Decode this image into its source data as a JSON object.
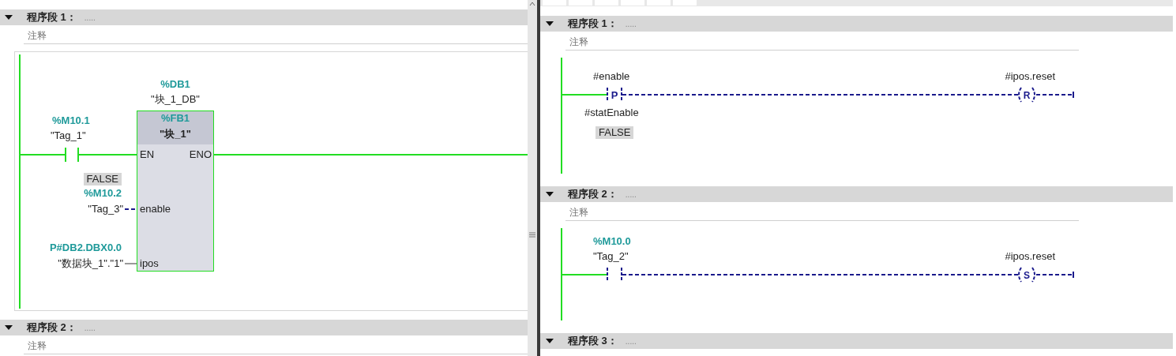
{
  "left_pane": {
    "networks": [
      {
        "title": "程序段 1：",
        "dots": ".....",
        "expanded": true,
        "comment": "注释",
        "rung": {
          "kind": "fb_call",
          "instance": {
            "address": "%DB1",
            "name": "\"块_1_DB\""
          },
          "block": {
            "address": "%FB1",
            "name": "\"块_1\""
          },
          "contact": {
            "address": "%M10.1",
            "name": "\"Tag_1\""
          },
          "en": "EN",
          "eno": "ENO",
          "inputs": [
            {
              "kind": "bool",
              "pin": "enable",
              "value": "FALSE",
              "address": "%M10.2",
              "name": "\"Tag_3\""
            },
            {
              "kind": "pointer",
              "pin": "ipos",
              "address": "P#DB2.DBX0.0",
              "name": "\"数据块_1\".\"1\""
            }
          ]
        }
      },
      {
        "title": "程序段 2：",
        "dots": ".....",
        "expanded": true,
        "comment": "注释"
      }
    ]
  },
  "right_pane": {
    "networks": [
      {
        "title": "程序段 1：",
        "dots": ".....",
        "expanded": true,
        "comment": "注释",
        "rung": {
          "kind": "contact_coil",
          "contact": {
            "operand": "#enable",
            "letter": "P",
            "edge_memory": "#statEnable",
            "value": "FALSE"
          },
          "coil": {
            "operand": "#ipos.reset",
            "letter": "R"
          }
        }
      },
      {
        "title": "程序段 2：",
        "dots": ".....",
        "expanded": true,
        "comment": "注释",
        "rung": {
          "kind": "contact_coil",
          "contact": {
            "address": "%M10.0",
            "name": "\"Tag_2\""
          },
          "coil": {
            "operand": "#ipos.reset",
            "letter": "S"
          }
        }
      },
      {
        "title": "程序段 3：",
        "dots": ".....",
        "expanded": true
      }
    ]
  }
}
